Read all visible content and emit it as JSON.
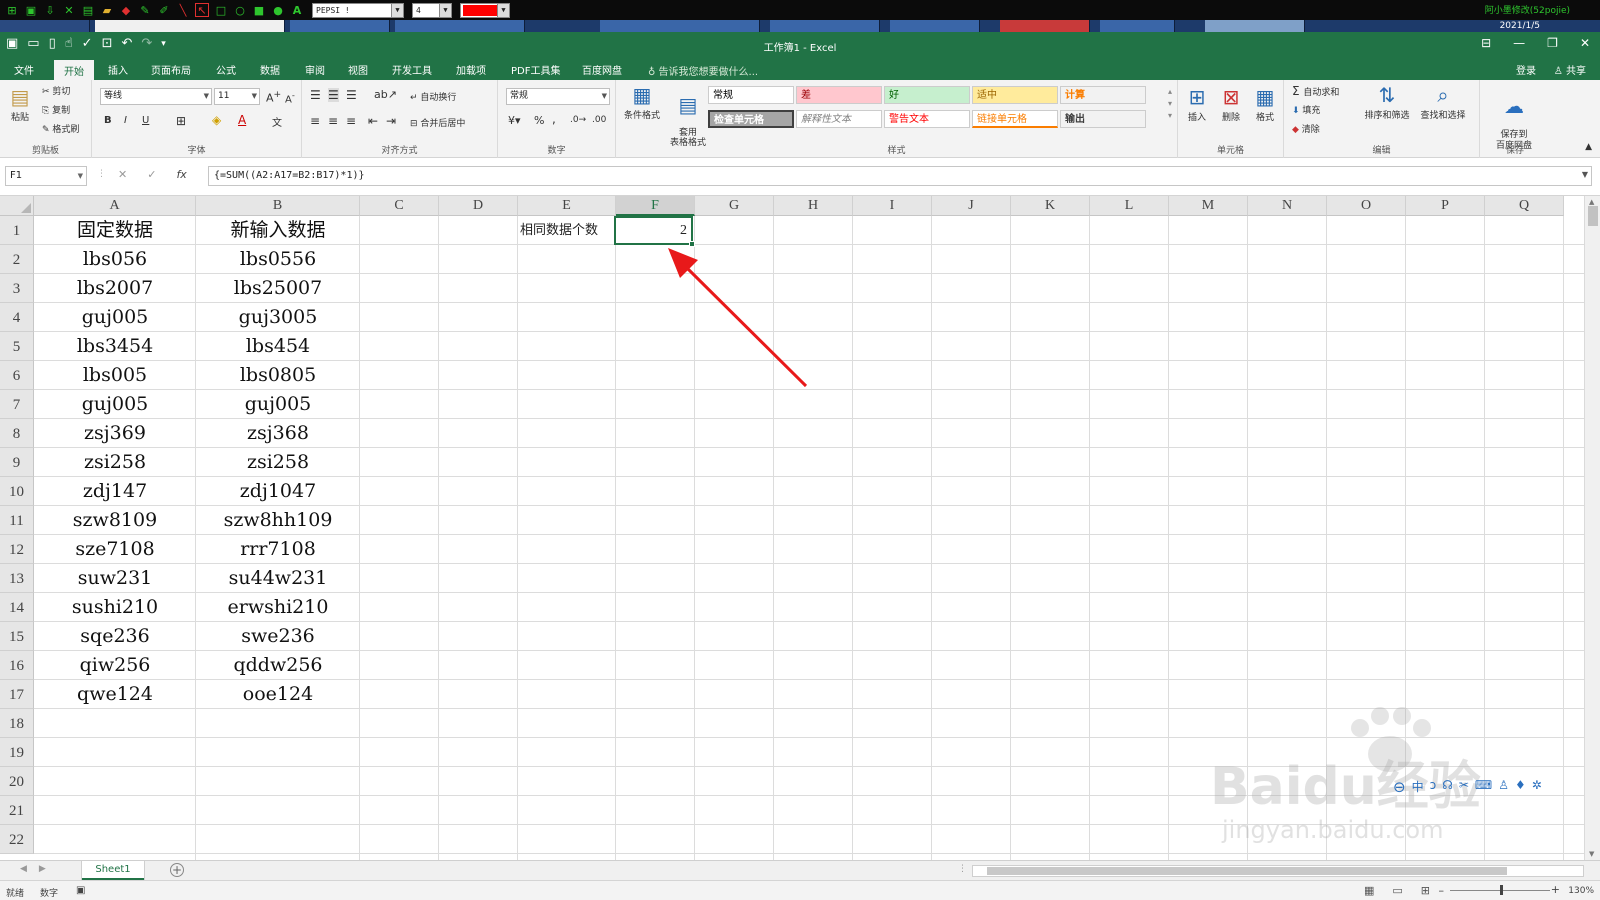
{
  "annotation_toolbar": {
    "font_name": "PEPSI !",
    "font_size": "4",
    "color": "#ff0000",
    "right_text": "阿小墨修改(52pojie)"
  },
  "taskbar": {
    "date": "2021/1/5"
  },
  "window": {
    "title": "工作簿1 - Excel"
  },
  "ribbon_tabs": [
    "文件",
    "开始",
    "插入",
    "页面布局",
    "公式",
    "数据",
    "审阅",
    "视图",
    "开发工具",
    "加载项",
    "PDF工具集",
    "百度网盘"
  ],
  "active_tab": "开始",
  "tell_me": "告诉我您想要做什么...",
  "login": "登录",
  "share": "共享",
  "clipboard": {
    "paste": "粘贴",
    "cut": "剪切",
    "copy": "复制",
    "format_painter": "格式刷",
    "label": "剪贴板"
  },
  "font": {
    "name": "等线",
    "size": "11",
    "label": "字体",
    "bold": "B",
    "italic": "I",
    "underline": "U"
  },
  "alignment": {
    "wrap": "自动换行",
    "merge": "合并后居中",
    "label": "对齐方式"
  },
  "number": {
    "format": "常规",
    "label": "数字",
    "percent": "%",
    "comma": ","
  },
  "styles": {
    "conditional": "条件格式",
    "table": "套用\n表格格式",
    "cells": [
      {
        "text": "常规",
        "bg": "#ffffff",
        "fg": "#000000"
      },
      {
        "text": "差",
        "bg": "#ffc7ce",
        "fg": "#9c0006"
      },
      {
        "text": "好",
        "bg": "#c6efce",
        "fg": "#006100"
      },
      {
        "text": "适中",
        "bg": "#ffeb9c",
        "fg": "#9c6500"
      },
      {
        "text": "计算",
        "bg": "#f2f2f2",
        "fg": "#fa7d00"
      },
      {
        "text": "检查单元格",
        "bg": "#a5a5a5",
        "fg": "#ffffff"
      },
      {
        "text": "解释性文本",
        "bg": "#ffffff",
        "fg": "#7f7f7f"
      },
      {
        "text": "警告文本",
        "bg": "#ffffff",
        "fg": "#ff0000"
      },
      {
        "text": "链接单元格",
        "bg": "#ffffff",
        "fg": "#fa7d00"
      },
      {
        "text": "输出",
        "bg": "#f2f2f2",
        "fg": "#3f3f3f"
      }
    ],
    "label": "样式"
  },
  "cells_group": {
    "insert": "插入",
    "delete": "删除",
    "format": "格式",
    "label": "单元格"
  },
  "editing": {
    "autosum": "自动求和",
    "fill": "填充",
    "clear": "清除",
    "sort": "排序和筛选",
    "find": "查找和选择",
    "label": "编辑"
  },
  "save_group": {
    "save": "保存到\n百度网盘",
    "label": "保存"
  },
  "formula_bar": {
    "name_box": "F1",
    "formula": "{=SUM((A2:A17=B2:B17)*1)}",
    "fx": "fx"
  },
  "columns": [
    "A",
    "B",
    "C",
    "D",
    "E",
    "F",
    "G",
    "H",
    "I",
    "J",
    "K",
    "L",
    "M",
    "N",
    "O",
    "P",
    "Q"
  ],
  "selected_column": "F",
  "rows": [
    "1",
    "2",
    "3",
    "4",
    "5",
    "6",
    "7",
    "8",
    "9",
    "10",
    "11",
    "12",
    "13",
    "14",
    "15",
    "16",
    "17",
    "18",
    "19",
    "20",
    "21",
    "22"
  ],
  "sheet_data": {
    "a_header": "固定数据",
    "b_header": "新输入数据",
    "col_a": [
      "lbs056",
      "lbs2007",
      "guj005",
      "lbs3454",
      "lbs005",
      "guj005",
      "zsj369",
      "zsi258",
      "zdj147",
      "szw8109",
      "sze7108",
      "suw231",
      "sushi210",
      "sqe236",
      "qiw256",
      "qwe124"
    ],
    "col_b": [
      "lbs0556",
      "lbs25007",
      "guj3005",
      "lbs454",
      "lbs0805",
      "guj005",
      "zsj368",
      "zsi258",
      "zdj1047",
      "szw8hh109",
      "rrr7108",
      "su44w231",
      "erwshi210",
      "swe236",
      "qddw256",
      "ooe124"
    ],
    "e1": "相同数据个数",
    "f1": "2"
  },
  "sheet_tabs": [
    "Sheet1"
  ],
  "status": {
    "ready": "就绪",
    "num": "数字",
    "zoom": "130%"
  },
  "watermark": {
    "main": "Baidu经验",
    "sub": "jingyan.baidu.com"
  },
  "arrow_color": "#e8191a"
}
